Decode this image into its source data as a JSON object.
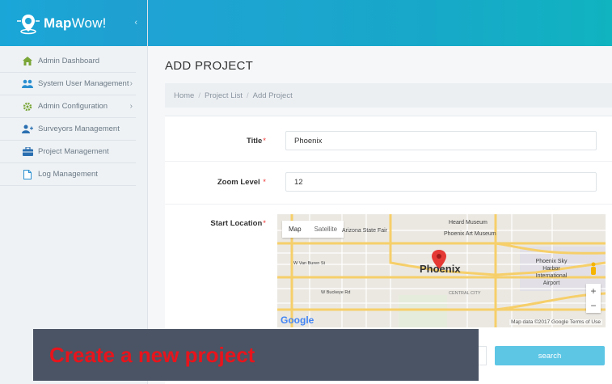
{
  "brand": {
    "name_bold": "Map",
    "name_light": "Wow!",
    "toggle": "‹"
  },
  "sidebar": {
    "items": [
      {
        "label": "Admin Dashboard",
        "icon": "home-icon",
        "chevron": ""
      },
      {
        "label": "System User Management",
        "icon": "users-icon",
        "chevron": "›"
      },
      {
        "label": "Admin Configuration",
        "icon": "gear-icon",
        "chevron": "›"
      },
      {
        "label": "Surveyors Management",
        "icon": "add-user-icon",
        "chevron": ""
      },
      {
        "label": "Project Management",
        "icon": "briefcase-icon",
        "chevron": ""
      },
      {
        "label": "Log Management",
        "icon": "file-icon",
        "chevron": ""
      }
    ]
  },
  "main": {
    "title": "ADD PROJECT",
    "breadcrumb": [
      "Home",
      "Project List",
      "Add Project"
    ],
    "breadcrumb_sep": "/"
  },
  "form": {
    "title_label": "Title",
    "title_value": "Phoenix",
    "zoom_label": "Zoom Level",
    "zoom_value": "12",
    "location_label": "Start Location",
    "required_mark": "*"
  },
  "map": {
    "tab_map": "Map",
    "tab_satellite": "Satellite",
    "city": "Phoenix",
    "labels": {
      "heard_museum": "Heard Museum",
      "art_museum": "Phoenix Art Museum",
      "arizona_state_fair": "Arizona State Fair",
      "sky_harbor": "Phoenix Sky Harbor International Airport",
      "central_city": "CENTRAL CITY",
      "van_buren": "W Van Buren St",
      "buckeye": "W Buckeye Rd"
    },
    "google": "Google",
    "attribution": "Map data ©2017 Google   Terms of Use",
    "zoom_in": "+",
    "zoom_out": "−"
  },
  "search_button": "search",
  "caption": "Create a new project",
  "colors": {
    "accent": "#1fa3d4",
    "button": "#5dc6e5",
    "caption_bg": "#4a5464",
    "caption_text": "#e8141c"
  }
}
